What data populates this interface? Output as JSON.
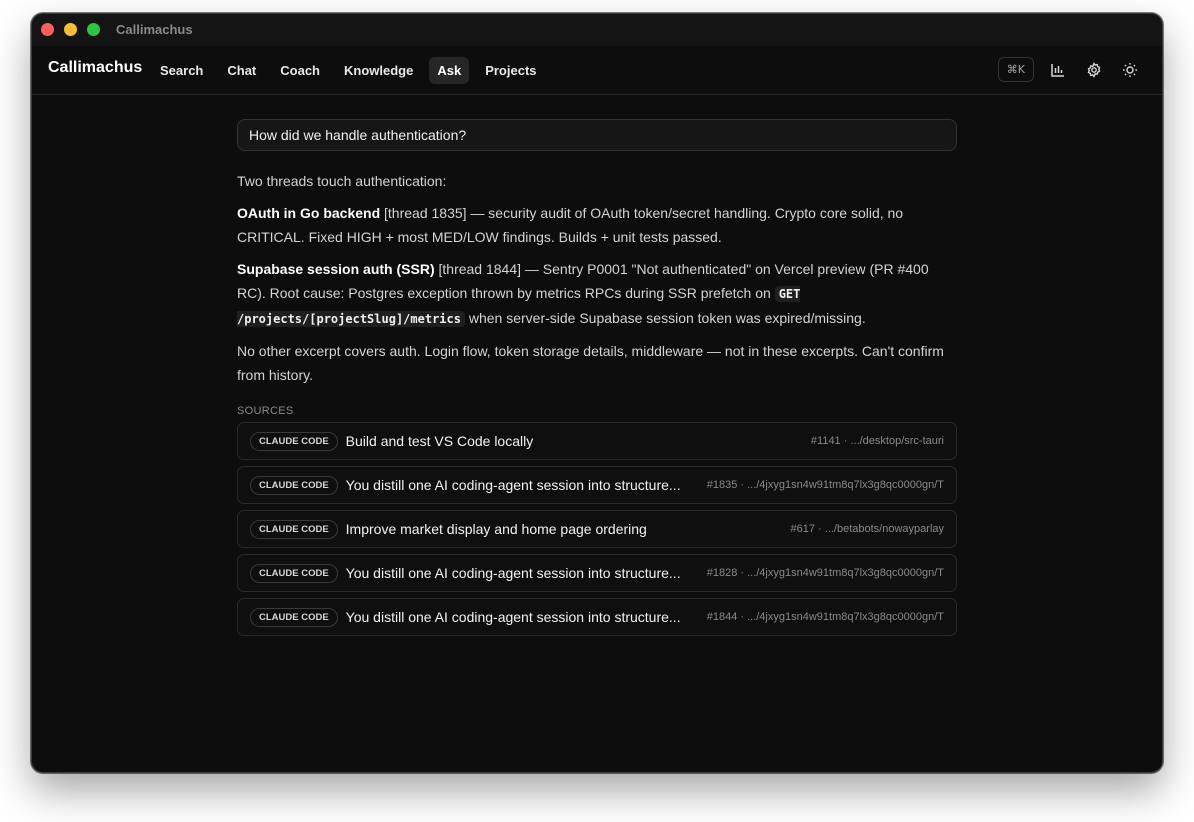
{
  "window": {
    "title": "Callimachus"
  },
  "nav": {
    "brand": "Callimachus",
    "items": [
      {
        "label": "Search"
      },
      {
        "label": "Chat"
      },
      {
        "label": "Coach"
      },
      {
        "label": "Knowledge"
      },
      {
        "label": "Ask",
        "active": true
      },
      {
        "label": "Projects"
      }
    ],
    "shortcut": "⌘K",
    "icons": [
      "bar-chart-icon",
      "gear-icon",
      "sun-icon"
    ]
  },
  "ask": {
    "query": "How did we handle authentication?"
  },
  "answer": {
    "intro": "Two threads touch authentication:",
    "item1": {
      "title": "OAuth in Go backend",
      "ref": "[thread 1835]",
      "text": " — security audit of OAuth token/secret handling. Crypto core solid, no CRITICAL. Fixed HIGH + most MED/LOW findings. Builds + unit tests passed."
    },
    "item2": {
      "title": "Supabase session auth (SSR)",
      "ref": "[thread 1844]",
      "text_before": " — Sentry P0001 \"Not authenticated\" on Vercel preview (PR #400 RC). Root cause: Postgres exception thrown by metrics RPCs during SSR prefetch on ",
      "code": "GET /projects/[projectSlug]/metrics",
      "text_after": " when server-side Supabase session token was expired/missing."
    },
    "closing": "No other excerpt covers auth. Login flow, token storage details, middleware — not in these excerpts. Can't confirm from history."
  },
  "sources": {
    "label": "SOURCES",
    "items": [
      {
        "badge": "CLAUDE CODE",
        "title": "Build and test VS Code locally",
        "meta": "#1141 · .../desktop/src-tauri"
      },
      {
        "badge": "CLAUDE CODE",
        "title": "You distill one AI coding-agent session into structure...",
        "meta": "#1835 · .../4jxyg1sn4w91tm8q7lx3g8qc0000gn/T"
      },
      {
        "badge": "CLAUDE CODE",
        "title": "Improve market display and home page ordering",
        "meta": "#617 · .../betabots/nowayparlay"
      },
      {
        "badge": "CLAUDE CODE",
        "title": "You distill one AI coding-agent session into structure...",
        "meta": "#1828 · .../4jxyg1sn4w91tm8q7lx3g8qc0000gn/T"
      },
      {
        "badge": "CLAUDE CODE",
        "title": "You distill one AI coding-agent session into structure...",
        "meta": "#1844 · .../4jxyg1sn4w91tm8q7lx3g8qc0000gn/T"
      }
    ]
  }
}
